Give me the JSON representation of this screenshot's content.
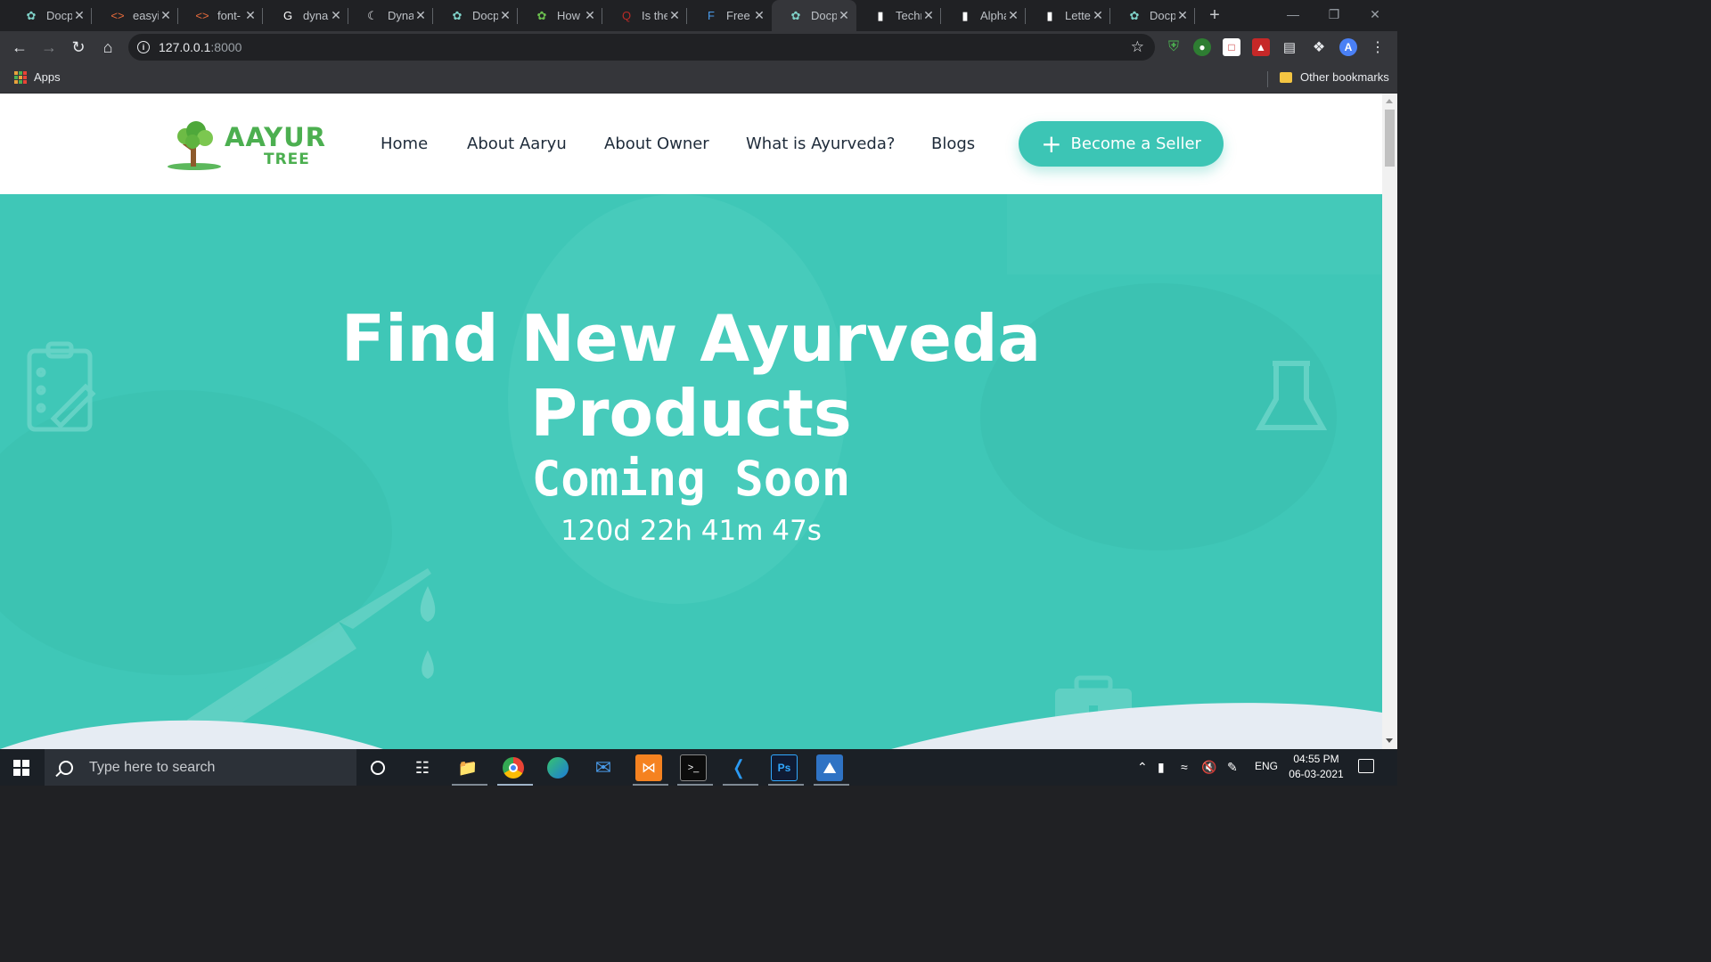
{
  "browser": {
    "tabs": [
      {
        "title": "Docp",
        "icon": "docpad-icon"
      },
      {
        "title": "easyi",
        "icon": "code-icon"
      },
      {
        "title": "font-",
        "icon": "code-icon"
      },
      {
        "title": "dyna",
        "icon": "google-icon"
      },
      {
        "title": "Dyna",
        "icon": "moon-icon"
      },
      {
        "title": "Docp",
        "icon": "docpad-icon"
      },
      {
        "title": "How",
        "icon": "w3-icon"
      },
      {
        "title": "Is the",
        "icon": "quora-icon"
      },
      {
        "title": "Free",
        "icon": "flaticon-icon"
      },
      {
        "title": "Docp",
        "icon": "docpad-icon",
        "active": true
      },
      {
        "title": "Techr",
        "icon": "bracket-icon"
      },
      {
        "title": "Alpha",
        "icon": "bracket-icon"
      },
      {
        "title": "Lette",
        "icon": "bracket-icon"
      },
      {
        "title": "Docp",
        "icon": "docpad-icon"
      }
    ],
    "url_host": "127.0.0.1",
    "url_port": ":8000",
    "bookmarks": {
      "apps_label": "Apps",
      "other_label": "Other bookmarks"
    }
  },
  "site": {
    "logo": {
      "line1": "AAYUR",
      "line2": "TREE"
    },
    "nav": [
      "Home",
      "About Aaryu",
      "About Owner",
      "What is Ayurveda?",
      "Blogs"
    ],
    "cta_label": "Become a Seller",
    "hero": {
      "title_line1": "Find New Ayurveda",
      "title_line2": "Products",
      "subtitle": "Coming Soon",
      "countdown": "120d 22h 41m 47s"
    },
    "colors": {
      "accent": "#3fc7b7",
      "button": "#3cc5b5",
      "logo_green": "#4caf50"
    }
  },
  "taskbar": {
    "search_placeholder": "Type here to search",
    "language": "ENG",
    "time": "04:55 PM",
    "date": "06-03-2021"
  }
}
